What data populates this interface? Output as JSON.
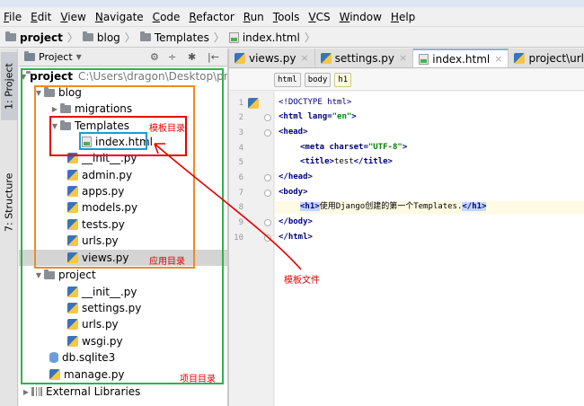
{
  "menu": [
    "File",
    "Edit",
    "View",
    "Navigate",
    "Code",
    "Refactor",
    "Run",
    "Tools",
    "VCS",
    "Window",
    "Help"
  ],
  "breadcrumb": [
    "project",
    "blog",
    "Templates",
    "index.html"
  ],
  "sidebar_tabs": [
    "1: Project",
    "7: Structure"
  ],
  "project_panel": {
    "title": "Project",
    "tool_icons": [
      "⚙",
      "÷",
      "✱",
      "|←"
    ]
  },
  "tree": {
    "root": {
      "name": "project",
      "path": "C:\\Users\\dragon\\Desktop\\pr"
    },
    "blog": "blog",
    "migrations": "migrations",
    "templates": "Templates",
    "index_html": "index.html",
    "blog_files": [
      "__init__.py",
      "admin.py",
      "apps.py",
      "models.py",
      "tests.py",
      "urls.py",
      "views.py"
    ],
    "project_pkg": "project",
    "project_files": [
      "__init__.py",
      "settings.py",
      "urls.py",
      "wsgi.py"
    ],
    "db": "db.sqlite3",
    "manage": "manage.py",
    "external": "External Libraries"
  },
  "editor_tabs": [
    "views.py",
    "settings.py",
    "index.html",
    "project\\urls.py"
  ],
  "tag_breadcrumb": [
    "html",
    "body",
    "h1"
  ],
  "line_numbers": [
    "1",
    "2",
    "3",
    "4",
    "5",
    "6",
    "7",
    "8",
    "9",
    "10"
  ],
  "code": {
    "doctype": "<!DOCTYPE html>",
    "html_open": "<html ",
    "lang_attr": "lang=",
    "lang_val": "\"en\"",
    "html_end": ">",
    "head_open": "<head>",
    "meta_open": "<meta ",
    "charset_attr": "charset=",
    "charset_val": "\"UTF-8\"",
    "meta_end": ">",
    "title_open": "<title>",
    "title_text": "test",
    "title_close": "</title>",
    "head_close": "</head>",
    "body_open": "<body>",
    "h1_open": "<h1>",
    "h1_text": "使用Django创建的第一个Templates.",
    "h1_close": "</h1>",
    "body_close": "</body>",
    "html_close": "</html>"
  },
  "annotations": {
    "templates_dir": "模板目录",
    "app_dir": "应用目录",
    "project_dir": "项目目录",
    "template_file": "模板文件"
  },
  "colors": {
    "red": "#e60000",
    "orange": "#f08a24",
    "green": "#2fb24a",
    "blue": "#1e9ad6"
  }
}
